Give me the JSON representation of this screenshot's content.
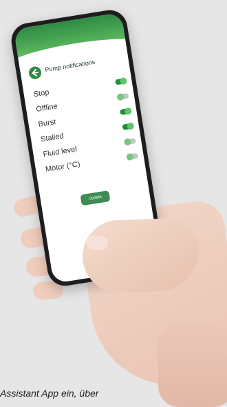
{
  "screen": {
    "title": "Pump notifications",
    "toggles": [
      {
        "label": "Stop",
        "state": "on"
      },
      {
        "label": "Offline",
        "state": "off"
      },
      {
        "label": "Burst",
        "state": "on"
      },
      {
        "label": "Stalled",
        "state": "on"
      },
      {
        "label": "Fluid level",
        "state": "off"
      },
      {
        "label": "Motor (°C)",
        "state": "off"
      }
    ],
    "update_label": "Update"
  },
  "caption": "Assistant App ein, über"
}
